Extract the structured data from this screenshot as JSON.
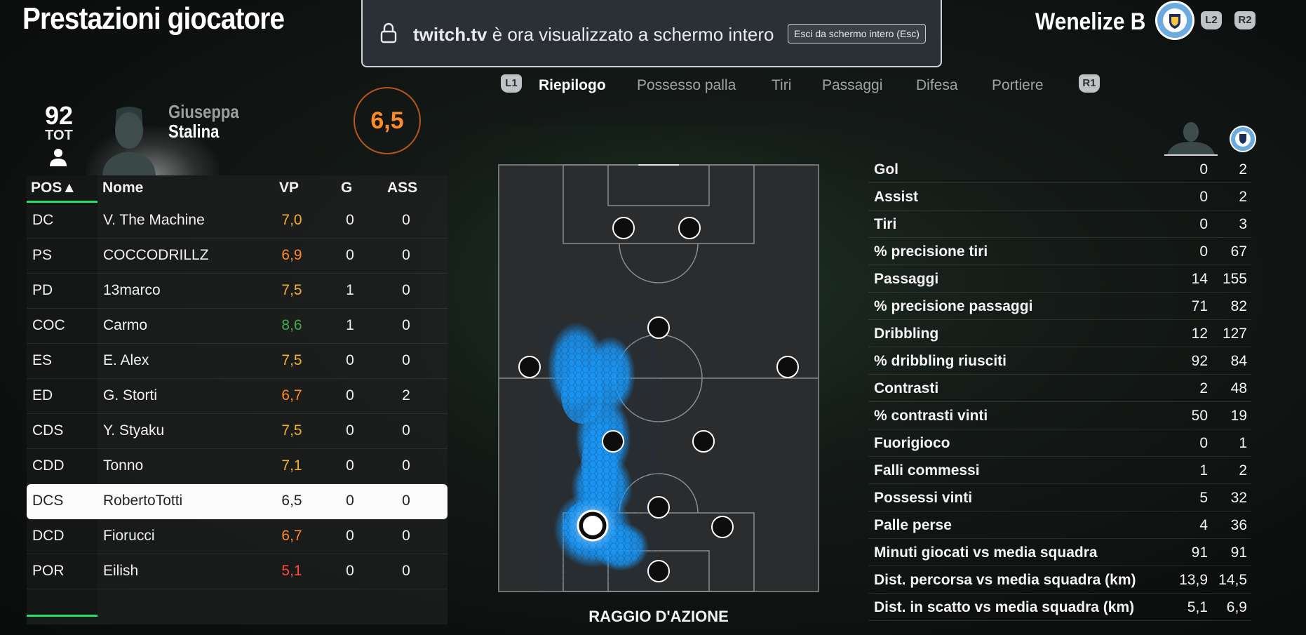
{
  "page_title": "Prestazioni giocatore",
  "notice": {
    "domain": "twitch.tv",
    "message": "è ora visualizzato a schermo intero",
    "exit_label": "Esci da schermo intero (Esc)"
  },
  "team": {
    "name": "Wenelize B",
    "left_button": "L2",
    "right_button": "R2"
  },
  "player": {
    "rating": "92",
    "rating_label": "TOT",
    "first_name": "Giuseppa",
    "last_name": "Stalina",
    "match_rating": "6,5"
  },
  "table": {
    "headers": {
      "pos": "POS▲",
      "name": "Nome",
      "vp": "VP",
      "g": "G",
      "ass": "ASS"
    },
    "rows": [
      {
        "pos": "DC",
        "name": "V. The Machine",
        "vp": "7,0",
        "vp_color": "#f2b12c",
        "g": "0",
        "a": "0",
        "selected": false
      },
      {
        "pos": "PS",
        "name": "COCCODRILLZ",
        "vp": "6,9",
        "vp_color": "#ff8a2a",
        "g": "0",
        "a": "0",
        "selected": false
      },
      {
        "pos": "PD",
        "name": "13marco",
        "vp": "7,5",
        "vp_color": "#f2b12c",
        "g": "1",
        "a": "0",
        "selected": false
      },
      {
        "pos": "COC",
        "name": "Carmo",
        "vp": "8,6",
        "vp_color": "#3fae49",
        "g": "1",
        "a": "0",
        "selected": false
      },
      {
        "pos": "ES",
        "name": "E. Alex",
        "vp": "7,5",
        "vp_color": "#f2b12c",
        "g": "0",
        "a": "0",
        "selected": false
      },
      {
        "pos": "ED",
        "name": "G. Storti",
        "vp": "6,7",
        "vp_color": "#ff8a2a",
        "g": "0",
        "a": "2",
        "selected": false
      },
      {
        "pos": "CDS",
        "name": "Y. Styaku",
        "vp": "7,5",
        "vp_color": "#f2b12c",
        "g": "0",
        "a": "0",
        "selected": false
      },
      {
        "pos": "CDD",
        "name": "Tonno",
        "vp": "7,1",
        "vp_color": "#f2b12c",
        "g": "0",
        "a": "0",
        "selected": false
      },
      {
        "pos": "DCS",
        "name": "RobertoTotti",
        "vp": "6,5",
        "vp_color": "#222222",
        "g": "0",
        "a": "0",
        "selected": true
      },
      {
        "pos": "DCD",
        "name": "Fiorucci",
        "vp": "6,7",
        "vp_color": "#ff8a2a",
        "g": "0",
        "a": "0",
        "selected": false
      },
      {
        "pos": "POR",
        "name": "Eilish",
        "vp": "5,1",
        "vp_color": "#ff4a3a",
        "g": "0",
        "a": "0",
        "selected": false
      }
    ]
  },
  "tabs": {
    "prev_button": "L1",
    "next_button": "R1",
    "items": [
      {
        "label": "Riepilogo",
        "active": true
      },
      {
        "label": "Possesso palla",
        "active": false
      },
      {
        "label": "Tiri",
        "active": false
      },
      {
        "label": "Passaggi",
        "active": false
      },
      {
        "label": "Difesa",
        "active": false
      },
      {
        "label": "Portiere",
        "active": false
      }
    ]
  },
  "pitch": {
    "label": "RAGGIO D'AZIONE",
    "heat_color": "#1a9bff"
  },
  "stats": [
    {
      "label": "Gol",
      "player": "0",
      "team": "2"
    },
    {
      "label": "Assist",
      "player": "0",
      "team": "2"
    },
    {
      "label": "Tiri",
      "player": "0",
      "team": "3"
    },
    {
      "label": "% precisione tiri",
      "player": "0",
      "team": "67"
    },
    {
      "label": "Passaggi",
      "player": "14",
      "team": "155"
    },
    {
      "label": "% precisione passaggi",
      "player": "71",
      "team": "82"
    },
    {
      "label": "Dribbling",
      "player": "12",
      "team": "127"
    },
    {
      "label": "% dribbling riusciti",
      "player": "92",
      "team": "84"
    },
    {
      "label": "Contrasti",
      "player": "2",
      "team": "48"
    },
    {
      "label": "% contrasti vinti",
      "player": "50",
      "team": "19"
    },
    {
      "label": "Fuorigioco",
      "player": "0",
      "team": "1"
    },
    {
      "label": "Falli commessi",
      "player": "1",
      "team": "2"
    },
    {
      "label": "Possessi vinti",
      "player": "5",
      "team": "32"
    },
    {
      "label": "Palle perse",
      "player": "4",
      "team": "36"
    },
    {
      "label": "Minuti giocati vs media squadra",
      "player": "91",
      "team": "91"
    },
    {
      "label": "Dist. percorsa vs media squadra (km)",
      "player": "13,9",
      "team": "14,5"
    },
    {
      "label": "Dist. in scatto vs media squadra (km)",
      "player": "5,1",
      "team": "6,9"
    }
  ]
}
